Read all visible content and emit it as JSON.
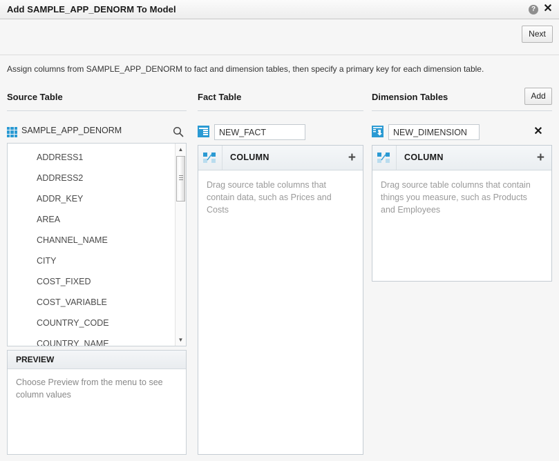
{
  "window": {
    "title": "Add SAMPLE_APP_DENORM To Model",
    "help_icon": "help-circle-icon",
    "close_icon": "close-icon"
  },
  "toolbar": {
    "next_label": "Next"
  },
  "instruction": "Assign columns from SAMPLE_APP_DENORM to fact and dimension tables, then specify a primary key for each dimension table.",
  "sections": {
    "source": {
      "title": "Source Table"
    },
    "fact": {
      "title": "Fact Table"
    },
    "dimension": {
      "title": "Dimension Tables",
      "add_label": "Add"
    }
  },
  "source_table": {
    "icon": "table-grid-icon",
    "name": "SAMPLE_APP_DENORM",
    "search_icon": "search-icon",
    "columns": [
      "ADDRESS1",
      "ADDRESS2",
      "ADDR_KEY",
      "AREA",
      "CHANNEL_NAME",
      "CITY",
      "COST_FIXED",
      "COST_VARIABLE",
      "COUNTRY_CODE",
      "COUNTRY_NAME"
    ],
    "scrollbar": {
      "up_arrow": "▲",
      "down_arrow": "▼"
    }
  },
  "preview": {
    "header": "PREVIEW",
    "message": "Choose Preview from the menu to see column values"
  },
  "fact_table": {
    "icon": "fact-table-icon",
    "name_value": "NEW_FACT",
    "name_placeholder": "NEW_FACT",
    "column_header": "COLUMN",
    "column_icon": "column-measure-icon",
    "add_column_icon": "plus-icon",
    "hint": "Drag source table columns that contain data, such as Prices and Costs"
  },
  "dimension_table": {
    "icon": "dimension-table-icon",
    "name_value": "NEW_DIMENSION",
    "name_placeholder": "NEW_DIMENSION",
    "remove_icon": "close-icon",
    "column_header": "COLUMN",
    "column_icon": "column-measure-icon",
    "add_column_icon": "plus-icon",
    "hint": "Drag source table columns that contain things you measure, such as Products and Employees"
  },
  "colors": {
    "accent_blue": "#2b9ad3",
    "title_text": "#1a1a1a",
    "hint_text": "#9a9a9a",
    "panel_border": "#c4ccd3"
  }
}
